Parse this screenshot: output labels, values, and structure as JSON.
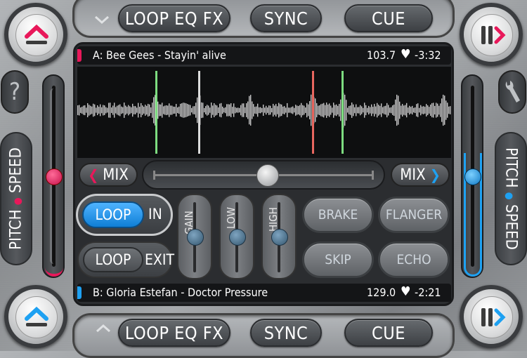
{
  "top_bar": {
    "fx_label": "LOOP EQ FX",
    "sync_label": "SYNC",
    "cue_label": "CUE"
  },
  "bottom_bar": {
    "fx_label": "LOOP EQ FX",
    "sync_label": "SYNC",
    "cue_label": "CUE"
  },
  "deck_a": {
    "track": "A: Bee Gees - Stayin' alive",
    "bpm": "103.7",
    "remaining": "-3:32",
    "accent": "#e8185a",
    "pitch_label": "PITCH",
    "speed_label": "SPEED"
  },
  "deck_b": {
    "track": "B: Gloria Estefan - Doctor Pressure",
    "bpm": "129.0",
    "remaining": "-2:21",
    "accent": "#1ea1f2",
    "pitch_label": "PITCH",
    "speed_label": "SPEED"
  },
  "mixer": {
    "mix_left": "MIX",
    "mix_right": "MIX",
    "crossfader": 0.52
  },
  "loop": {
    "loop_in_label": "LOOP",
    "in_label": "IN",
    "loop_exit_label": "LOOP",
    "exit_label": "EXIT"
  },
  "eq": {
    "gain_label": "GAIN",
    "low_label": "LOW",
    "high_label": "HIGH"
  },
  "effects": {
    "brake": "BRAKE",
    "flanger": "FLANGER",
    "skip": "SKIP",
    "echo": "ECHO"
  },
  "help_symbol": "?",
  "icons": {
    "play_pause": "play-pause-icon",
    "up": "chevron-up-icon",
    "help": "help-icon",
    "wrench": "wrench-icon",
    "heart": "heart-icon"
  }
}
